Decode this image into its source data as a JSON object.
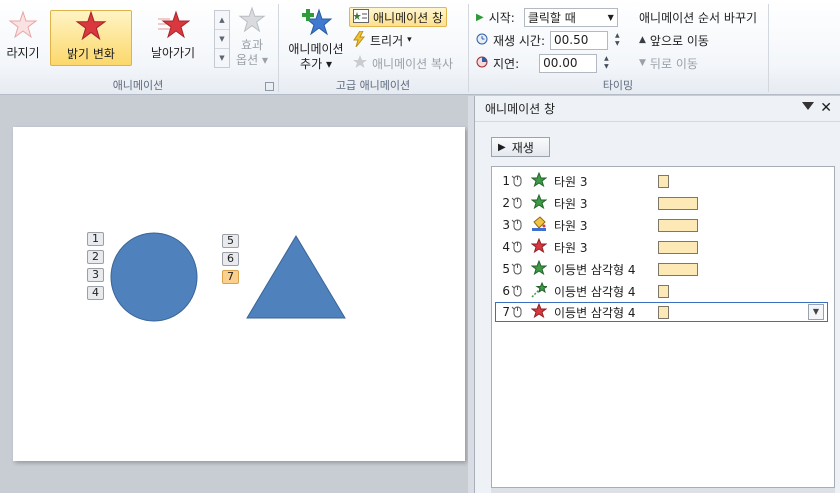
{
  "ribbon": {
    "gallery": {
      "items": [
        {
          "label": "라지기",
          "icon": "star-burst-icon"
        },
        {
          "label": "밝기 변화",
          "icon": "star-icon",
          "selected": true
        },
        {
          "label": "날아가기",
          "icon": "star-flying-icon"
        }
      ],
      "effect_options_label_1": "효과",
      "effect_options_label_2": "옵션",
      "group_label": "애니메이션"
    },
    "advanced": {
      "add_animation_label_1": "애니메이션",
      "add_animation_label_2": "추가",
      "animation_pane_label": "애니메이션 창",
      "trigger_label": "트리거",
      "animation_painter_label": "애니메이션 복사",
      "group_label": "고급 애니메이션"
    },
    "timing": {
      "start_label": "시작:",
      "start_value": "클릭할 때",
      "duration_label": "재생 시간:",
      "duration_value": "00.50",
      "delay_label": "지연:",
      "delay_value": "00.00",
      "reorder_label": "애니메이션 순서 바꾸기",
      "move_earlier_label": "앞으로 이동",
      "move_later_label": "뒤로 이동",
      "group_label": "타이밍"
    }
  },
  "slide": {
    "tags_left": [
      "1",
      "2",
      "3",
      "4"
    ],
    "tags_right": [
      "5",
      "6",
      "7"
    ],
    "active_tag": "7",
    "shape_colors": {
      "fill": "#4f81bd",
      "stroke": "#3a6597"
    }
  },
  "pane": {
    "title": "애니메이션 창",
    "play_label": "재생",
    "items": [
      {
        "num": "1",
        "name": "타원 3",
        "effect_icon": "star-green-icon",
        "bar": 0.2
      },
      {
        "num": "2",
        "name": "타원 3",
        "effect_icon": "star-green-icon",
        "bar": 0.8
      },
      {
        "num": "3",
        "name": "타원 3",
        "effect_icon": "paint-bucket-icon",
        "bar": 0.8
      },
      {
        "num": "4",
        "name": "타원 3",
        "effect_icon": "star-red-icon",
        "bar": 0.8
      },
      {
        "num": "5",
        "name": "이등변 삼각형 4",
        "effect_icon": "star-green-icon",
        "bar": 0.8
      },
      {
        "num": "6",
        "name": "이등변 삼각형 4",
        "effect_icon": "motion-path-icon",
        "bar": 0.2
      },
      {
        "num": "7",
        "name": "이등변 삼각형 4",
        "effect_icon": "star-red-icon",
        "bar": 0.2,
        "selected": true
      }
    ]
  },
  "colors": {
    "accent": "#3b6fbf",
    "selected_gallery": "#fcd86b",
    "bar_fill": "#fde9b6",
    "shape_fill": "#4f81bd"
  }
}
